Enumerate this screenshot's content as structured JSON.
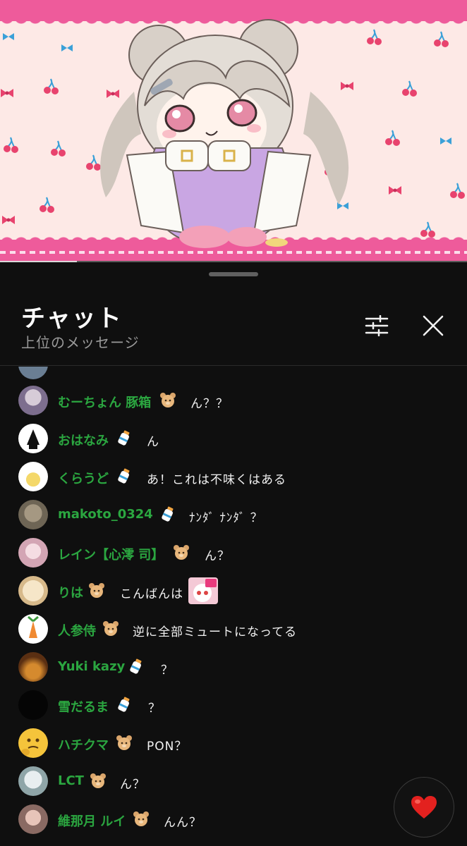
{
  "video": {
    "progress_fraction": 0.165,
    "colors": {
      "background": "#fde9e6",
      "band": "#ee5b9b",
      "cherry": "#e8436e",
      "leaf": "#3aa0d8"
    }
  },
  "chat": {
    "title": "チャット",
    "subtitle": "上位のメッセージ",
    "filter_icon": "sliders-icon",
    "close_icon": "close-icon"
  },
  "messages": [
    {
      "author": "むーちょん 豚箱",
      "badge": "bear-badge",
      "text": "ん？？"
    },
    {
      "author": "おはなみ",
      "badge": "milk-bottle-badge",
      "text": "ん"
    },
    {
      "author": "くらうど",
      "badge": "milk-bottle-badge",
      "text": "あ！これは不味くはある"
    },
    {
      "author": "makoto_0324",
      "badge": "milk-bottle-badge",
      "text": "ﾅﾝﾀﾞ ﾅﾝﾀﾞ ？"
    },
    {
      "author": "レイン【心澪 司】",
      "badge": "bear-badge",
      "text": "ん？"
    },
    {
      "author": "りは",
      "badge": "bear-badge",
      "text": "こんばんは"
    },
    {
      "author": "人参侍",
      "badge": "bear-badge",
      "text": "逆に全部ミュートになってる"
    },
    {
      "author": "Yuki kazy",
      "badge": "milk-bottle-badge",
      "text": "？"
    },
    {
      "author": "雪だるま",
      "badge": "milk-bottle-badge",
      "text": "？"
    },
    {
      "author": "ハチクマ",
      "badge": "bear-badge",
      "text": "PON？"
    },
    {
      "author": "LCT",
      "badge": "bear-badge",
      "text": "ん？"
    },
    {
      "author": "維那月 ルイ",
      "badge": "bear-badge",
      "text": "んん？"
    }
  ],
  "like_button": {
    "icon": "heart-icon",
    "color": "#e3211f"
  },
  "colors": {
    "author": "#2ba640",
    "panel": "#0f0f0f",
    "subtitle": "#9a9a9a"
  }
}
